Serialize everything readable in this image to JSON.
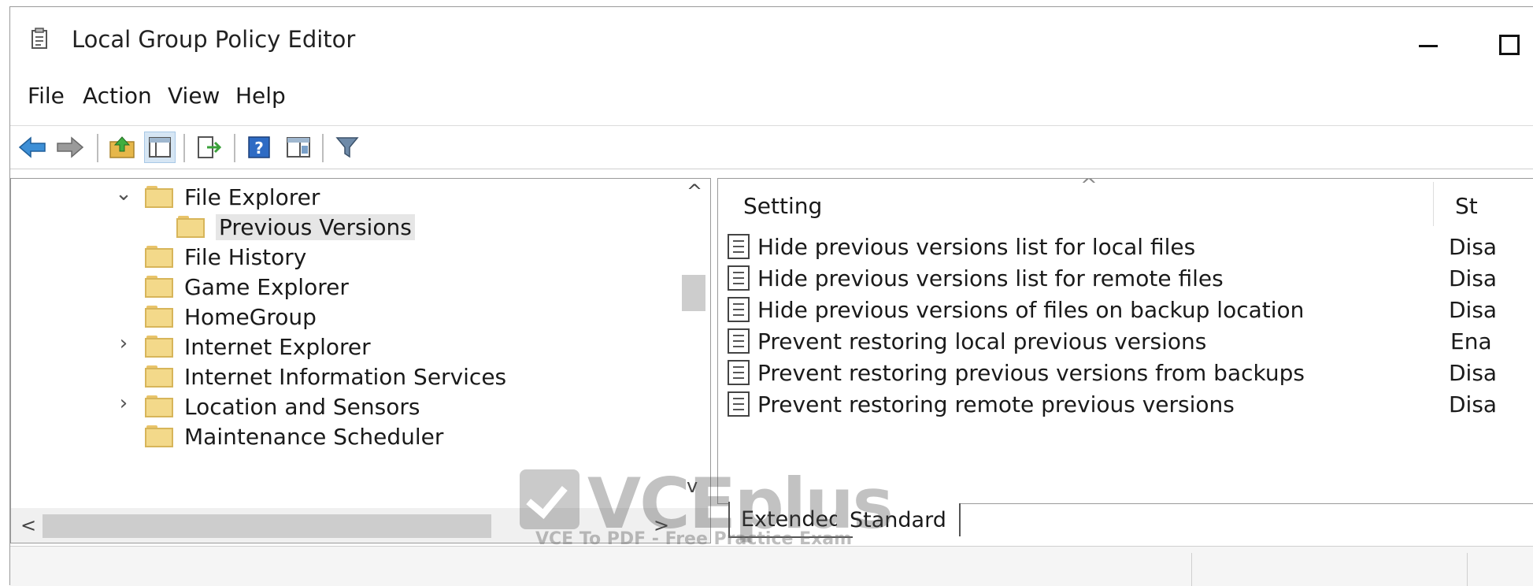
{
  "window": {
    "title": "Local Group Policy Editor"
  },
  "menu": [
    "File",
    "Action",
    "View",
    "Help"
  ],
  "toolbar": {
    "icons": [
      "back-arrow-icon",
      "forward-arrow-icon",
      "up-folder-icon",
      "show-hide-tree-icon",
      "export-list-icon",
      "help-icon",
      "properties-icon",
      "filter-icon"
    ],
    "help_glyph": "?"
  },
  "tree": {
    "items": [
      {
        "label": "File Explorer",
        "expanded": true,
        "chevron": "⌄"
      },
      {
        "label": "Previous Versions",
        "selected": true
      },
      {
        "label": "File History"
      },
      {
        "label": "Game Explorer"
      },
      {
        "label": "HomeGroup"
      },
      {
        "label": "Internet Explorer",
        "chevron": "›"
      },
      {
        "label": "Internet Information Services"
      },
      {
        "label": "Location and Sensors",
        "chevron": "›"
      },
      {
        "label": "Maintenance Scheduler"
      }
    ],
    "scroll_up": "^",
    "scroll_down": "v",
    "scroll_left": "<",
    "scroll_right": ">"
  },
  "list": {
    "columns": {
      "setting": "Setting",
      "state": "St"
    },
    "sort_indicator": "^",
    "rows": [
      {
        "setting": "Hide previous versions list for local files",
        "state": "Disa"
      },
      {
        "setting": "Hide previous versions list for remote files",
        "state": "Disa"
      },
      {
        "setting": "Hide previous versions of files on backup location",
        "state": "Disa"
      },
      {
        "setting": "Prevent restoring local previous versions",
        "state": "Ena"
      },
      {
        "setting": "Prevent restoring previous versions from backups",
        "state": "Disa"
      },
      {
        "setting": "Prevent restoring remote previous versions",
        "state": "Disa"
      }
    ]
  },
  "tabs": {
    "extended": "Extended",
    "standard": "Standard"
  },
  "watermark": {
    "logo": "VCEplus",
    "subtitle": "VCE To PDF - Free Practice Exam"
  },
  "colors": {
    "folder": "#f3d98a",
    "selection": "#e6e6e6",
    "toolbar_active": "#d6e6f4"
  }
}
